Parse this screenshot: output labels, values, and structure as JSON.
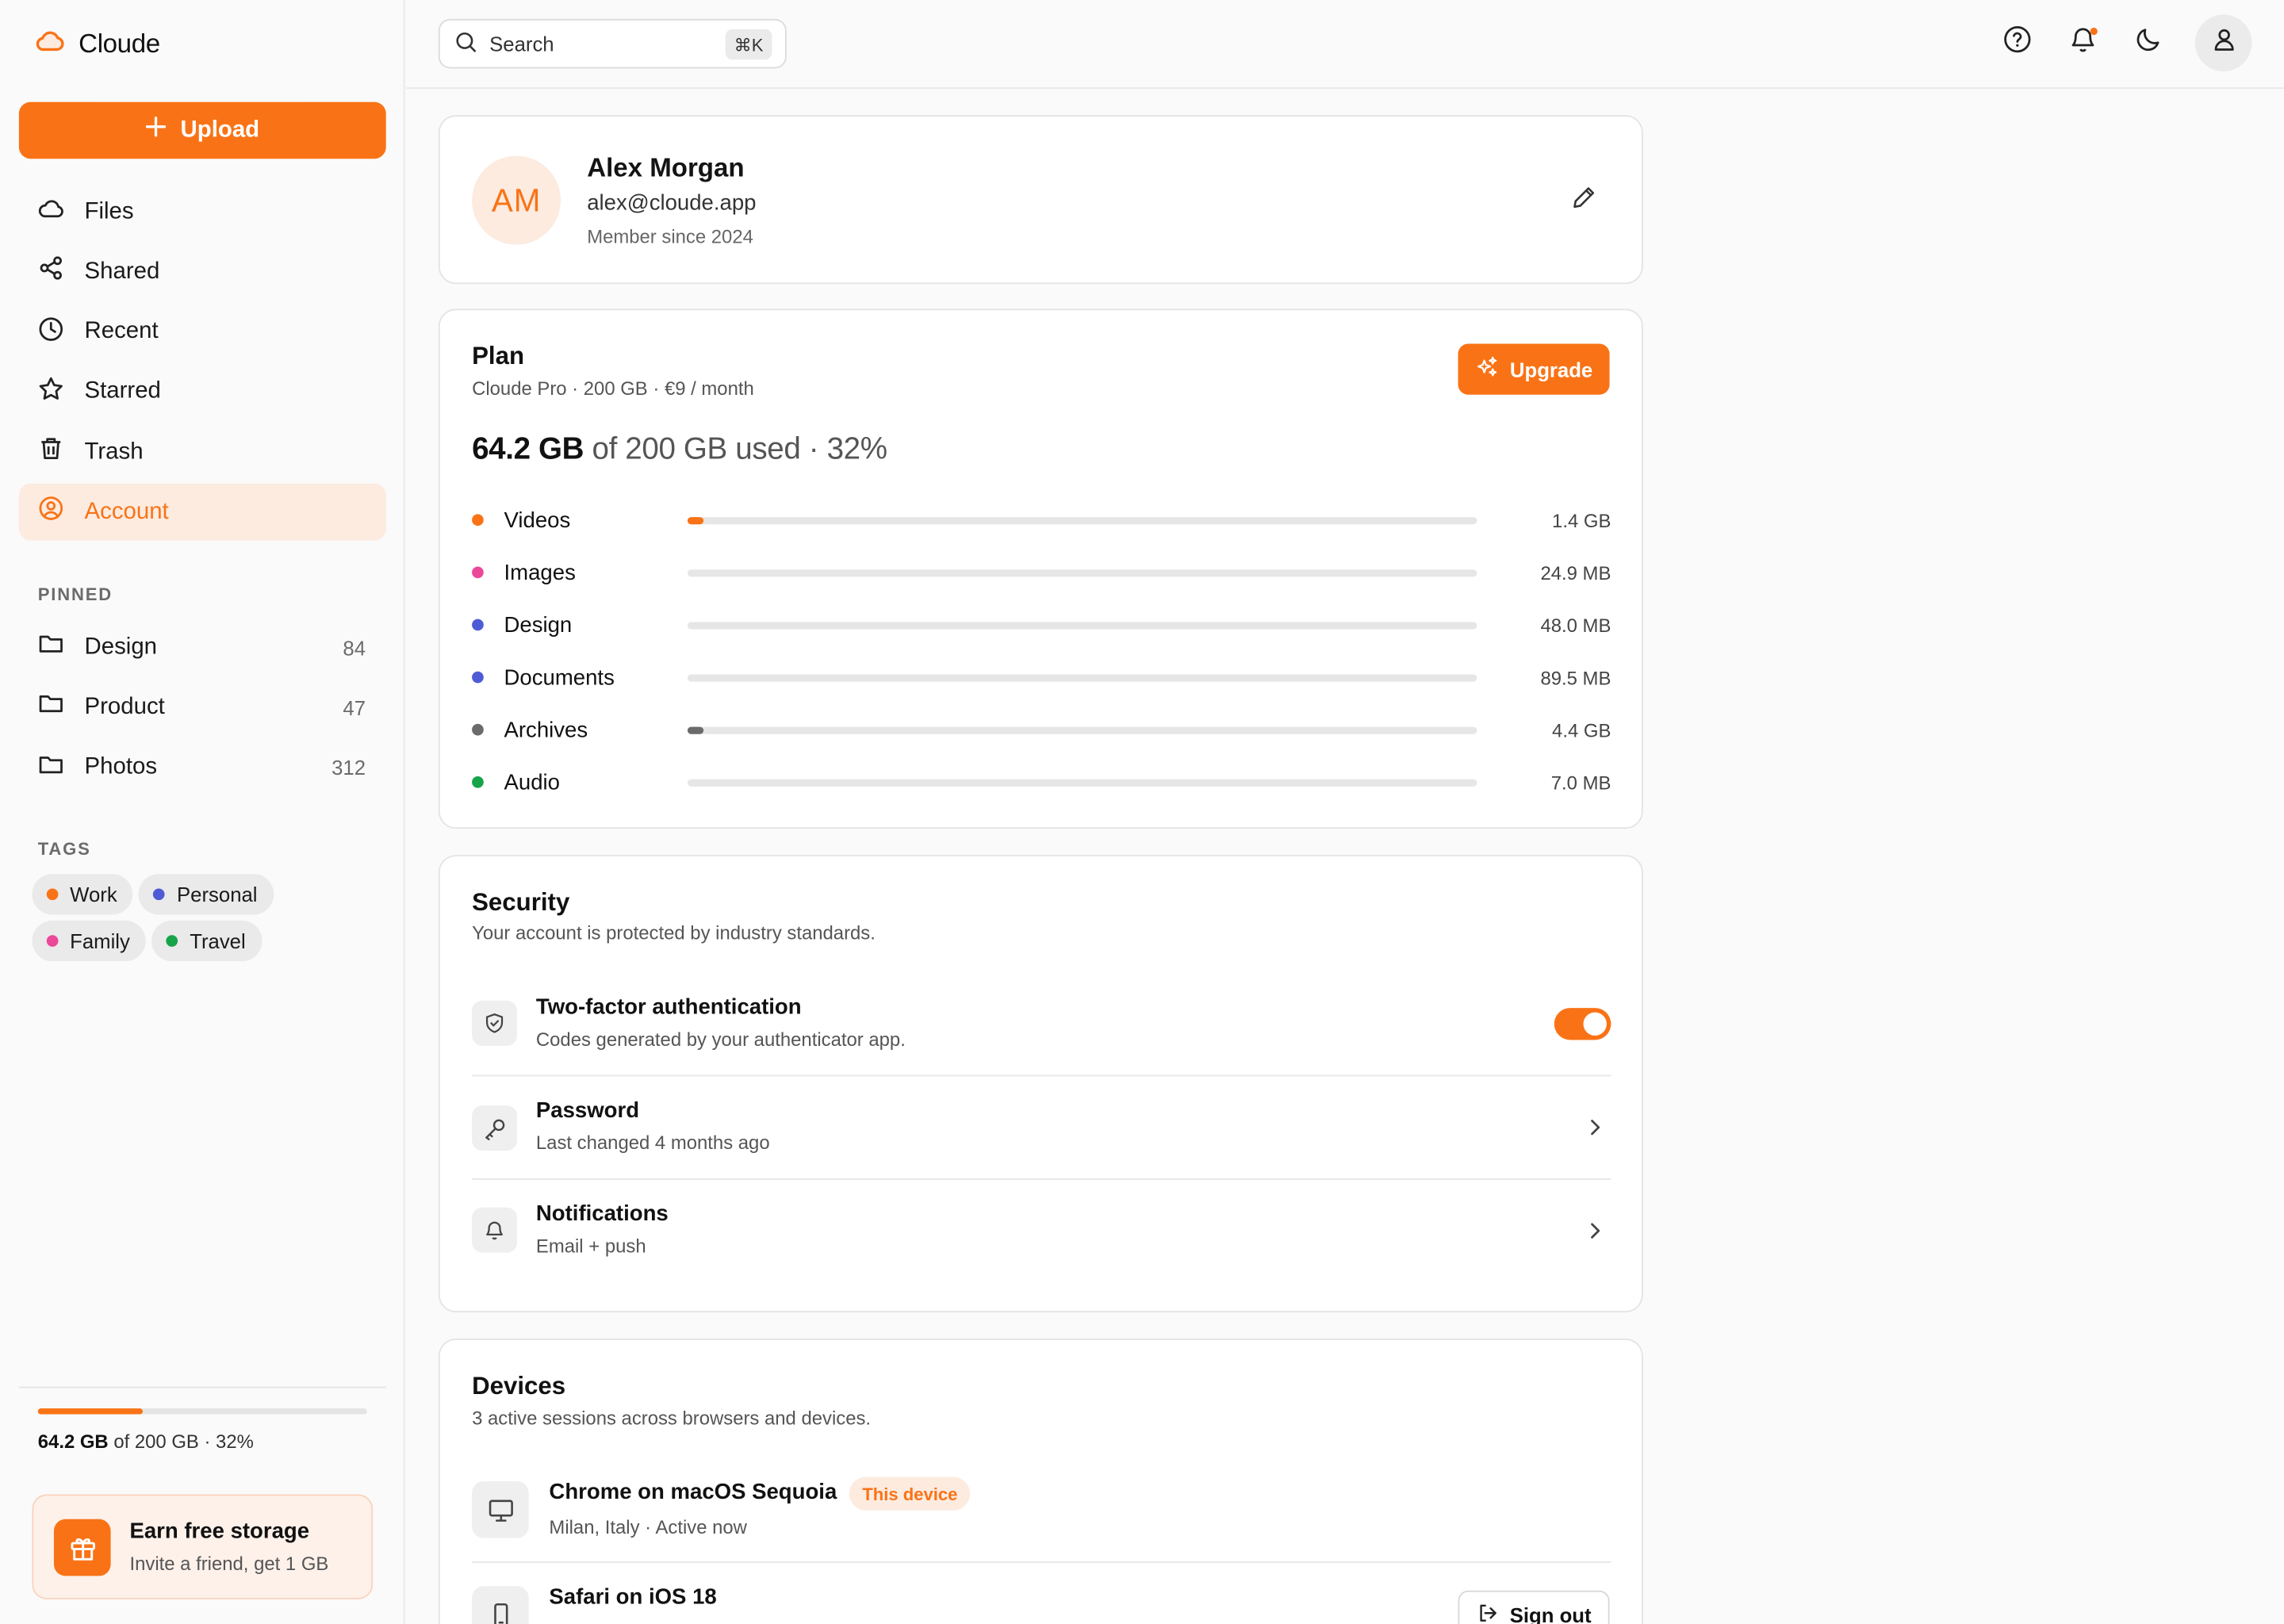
{
  "app": {
    "name": "Cloude",
    "brand_color": "#f97316"
  },
  "sidebar": {
    "upload_label": "Upload",
    "nav": [
      {
        "label": "Files",
        "icon": "cloud-icon"
      },
      {
        "label": "Shared",
        "icon": "share-icon"
      },
      {
        "label": "Recent",
        "icon": "clock-icon"
      },
      {
        "label": "Starred",
        "icon": "star-icon"
      },
      {
        "label": "Trash",
        "icon": "trash-icon"
      },
      {
        "label": "Account",
        "icon": "user-circle-icon",
        "active": true
      }
    ],
    "pinned_label": "PINNED",
    "pinned": [
      {
        "label": "Design",
        "count": "84"
      },
      {
        "label": "Product",
        "count": "47"
      },
      {
        "label": "Photos",
        "count": "312"
      }
    ],
    "tags_label": "TAGS",
    "tags": [
      {
        "label": "Work",
        "color": "#f97316"
      },
      {
        "label": "Personal",
        "color": "#4f5bd5"
      },
      {
        "label": "Family",
        "color": "#ec4899"
      },
      {
        "label": "Travel",
        "color": "#16a34a"
      }
    ],
    "storage": {
      "used": "64.2 GB",
      "rest": " of 200 GB · 32%",
      "fraction": 0.32
    },
    "earn": {
      "title": "Earn free storage",
      "subtitle": "Invite a friend, get 1 GB"
    }
  },
  "topbar": {
    "search_placeholder": "Search",
    "shortcut": "⌘K"
  },
  "profile": {
    "initials": "AM",
    "name": "Alex Morgan",
    "email": "alex@cloude.app",
    "since": "Member since 2024"
  },
  "plan": {
    "title": "Plan",
    "subtitle": "Cloude Pro · 200 GB · €9 / month",
    "upgrade_label": "Upgrade",
    "used": "64.2 GB",
    "used_rest": " of 200 GB used · 32%",
    "categories": [
      {
        "name": "Videos",
        "size": "1.4 GB",
        "color": "#f97316",
        "fraction": 0.02
      },
      {
        "name": "Images",
        "size": "24.9 MB",
        "color": "#ec4899",
        "fraction": 0.0
      },
      {
        "name": "Design",
        "size": "48.0 MB",
        "color": "#4f5bd5",
        "fraction": 0.0
      },
      {
        "name": "Documents",
        "size": "89.5 MB",
        "color": "#4f5bd5",
        "fraction": 0.0
      },
      {
        "name": "Archives",
        "size": "4.4 GB",
        "color": "#6b6b6b",
        "fraction": 0.02
      },
      {
        "name": "Audio",
        "size": "7.0 MB",
        "color": "#16a34a",
        "fraction": 0.0
      }
    ]
  },
  "security": {
    "title": "Security",
    "subtitle": "Your account is protected by industry standards.",
    "rows": [
      {
        "title": "Two-factor authentication",
        "subtitle": "Codes generated by your authenticator app.",
        "icon": "shield-icon",
        "enabled": true
      },
      {
        "title": "Password",
        "subtitle": "Last changed 4 months ago",
        "icon": "key-icon"
      },
      {
        "title": "Notifications",
        "subtitle": "Email + push",
        "icon": "bell-icon"
      }
    ]
  },
  "devices": {
    "title": "Devices",
    "subtitle": "3 active sessions across browsers and devices.",
    "list": [
      {
        "title": "Chrome on macOS Sequoia",
        "subtitle": "Milan, Italy · Active now",
        "badge": "This device",
        "icon": "monitor-icon"
      },
      {
        "title": "Safari on iOS 18",
        "icon": "phone-icon",
        "action": "Sign out"
      }
    ]
  }
}
